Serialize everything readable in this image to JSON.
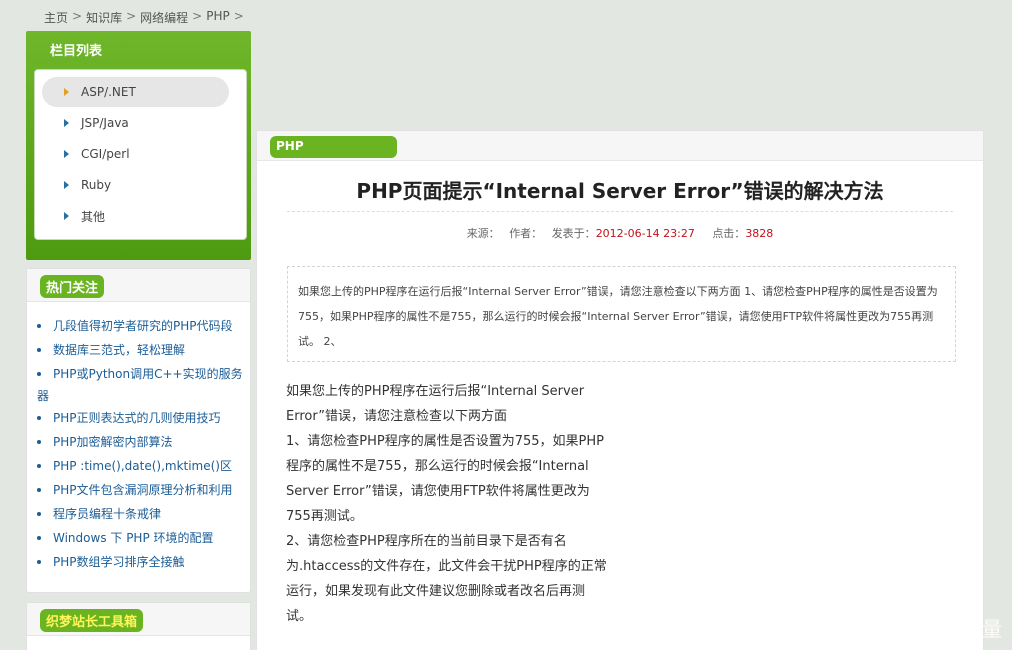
{
  "breadcrumb": {
    "items": [
      "主页",
      "知识库",
      "网络编程",
      "PHP"
    ],
    "separator": ">"
  },
  "categories": {
    "title": "栏目列表",
    "items": [
      {
        "label": "ASP/.NET",
        "active": true
      },
      {
        "label": "JSP/Java",
        "active": false
      },
      {
        "label": "CGI/perl",
        "active": false
      },
      {
        "label": "Ruby",
        "active": false
      },
      {
        "label": "其他",
        "active": false
      }
    ]
  },
  "hot": {
    "title": "热门关注",
    "items": [
      "几段值得初学者研究的PHP代码段",
      "数据库三范式，轻松理解",
      "PHP或Python调用C++实现的服务",
      "器",
      "PHP正则表达式的几则使用技巧",
      "PHP加密解密内部算法",
      "PHP :time(),date(),mktime()区",
      "PHP文件包含漏洞原理分析和利用",
      "程序员编程十条戒律",
      "Windows 下 PHP 环境的配置",
      "PHP数组学习排序全接触"
    ]
  },
  "toolbox": {
    "title": "织梦站长工具箱"
  },
  "article": {
    "tag": "PHP",
    "title": "PHP页面提示“Internal Server Error”错误的解决方法",
    "meta": {
      "source_label": "来源：",
      "author_label": "作者：",
      "published_label": "发表于：",
      "published_value": "2012-06-14 23:27",
      "clicks_label": "点击：",
      "clicks_value": "3828"
    },
    "summary": "如果您上传的PHP程序在运行后报“Internal Server Error”错误，请您注意检查以下两方面 1、请您检查PHP程序的属性是否设置为755，如果PHP程序的属性不是755，那么运行的时候会报“Internal Server Error”错误，请您使用FTP软件将属性更改为755再测试。 2、",
    "body_lines": [
      "如果您上传的PHP程序在运行后报“Internal Server",
      "Error”错误，请您注意检查以下两方面",
      "1、请您检查PHP程序的属性是否设置为755，如果PHP",
      "程序的属性不是755，那么运行的时候会报“Internal",
      "Server Error”错误，请您使用FTP软件将属性更改为",
      "755再测试。",
      "2、请您检查PHP程序所在的当前目录下是否有名",
      "为.htaccess的文件存在，此文件会干扰PHP程序的正常",
      "运行，如果发现有此文件建议您删除或者改名后再测",
      "试。"
    ]
  },
  "watermark": "量",
  "colors": {
    "accent_green": "#6ab422",
    "link_blue": "#1b5d96",
    "meta_red": "#c4121a",
    "background": "#e3e7e1"
  }
}
